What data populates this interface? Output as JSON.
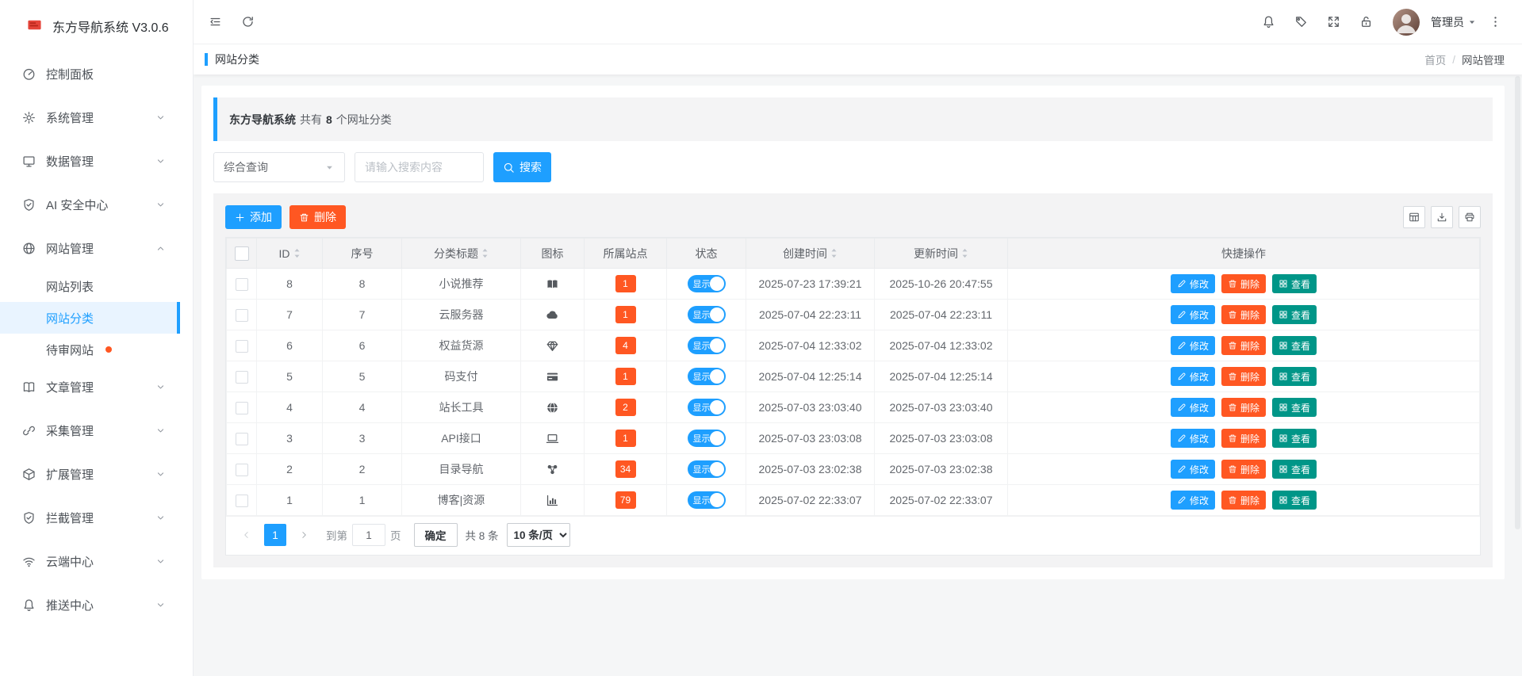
{
  "app": {
    "title": "东方导航系统 V3.0.6",
    "logo_icon": "flag"
  },
  "topbar": {
    "left_icons": [
      {
        "name": "sidebar-collapse-button",
        "icon": "collapse"
      },
      {
        "name": "refresh-button",
        "icon": "refresh"
      }
    ],
    "right_icons": [
      {
        "name": "notifications-button",
        "icon": "bell"
      },
      {
        "name": "tags-button",
        "icon": "tag"
      },
      {
        "name": "fullscreen-button",
        "icon": "expand"
      },
      {
        "name": "lock-screen-button",
        "icon": "unlock"
      }
    ],
    "user": "管理员",
    "more_icon": "kebab"
  },
  "breadcrumb": {
    "page_label": "网站分类",
    "home": "首页",
    "sep": "/",
    "current": "网站管理"
  },
  "sidebar": {
    "items": [
      {
        "label": "控制面板",
        "icon": "dashboard",
        "expandable": false
      },
      {
        "label": "系统管理",
        "icon": "gear",
        "expandable": true
      },
      {
        "label": "数据管理",
        "icon": "monitor",
        "expandable": true
      },
      {
        "label": "AI 安全中心",
        "icon": "shield-check",
        "expandable": true
      },
      {
        "label": "网站管理",
        "icon": "globe",
        "expandable": true,
        "expanded": true,
        "children": [
          {
            "label": "网站列表"
          },
          {
            "label": "网站分类",
            "active": true
          },
          {
            "label": "待审网站",
            "dot": true
          }
        ]
      },
      {
        "label": "文章管理",
        "icon": "book",
        "expandable": true
      },
      {
        "label": "采集管理",
        "icon": "link",
        "expandable": true
      },
      {
        "label": "扩展管理",
        "icon": "cube",
        "expandable": true
      },
      {
        "label": "拦截管理",
        "icon": "shield-check",
        "expandable": true
      },
      {
        "label": "云端中心",
        "icon": "wifi",
        "expandable": true
      },
      {
        "label": "推送中心",
        "icon": "bell",
        "expandable": true
      }
    ]
  },
  "summary": {
    "brand": "东方导航系统",
    "mid": "共有",
    "count": "8",
    "suffix": "个网址分类"
  },
  "search": {
    "select_value": "综合查询",
    "input_placeholder": "请输入搜索内容",
    "button_label": "搜索"
  },
  "toolbar": {
    "add_label": "添加",
    "delete_label": "删除",
    "tools": [
      {
        "name": "filter-columns-button",
        "icon": "columns"
      },
      {
        "name": "export-button",
        "icon": "export"
      },
      {
        "name": "print-button",
        "icon": "print"
      }
    ]
  },
  "table": {
    "columns": [
      {
        "key": "checkbox",
        "label": "",
        "type": "checkbox",
        "sortable": false
      },
      {
        "key": "id",
        "label": "ID",
        "sortable": true
      },
      {
        "key": "order",
        "label": "序号",
        "sortable": false
      },
      {
        "key": "title",
        "label": "分类标题",
        "sortable": true
      },
      {
        "key": "icon",
        "label": "图标",
        "sortable": false
      },
      {
        "key": "site_count",
        "label": "所属站点",
        "sortable": false
      },
      {
        "key": "status",
        "label": "状态",
        "sortable": false
      },
      {
        "key": "created",
        "label": "创建时间",
        "sortable": true
      },
      {
        "key": "updated",
        "label": "更新时间",
        "sortable": true
      },
      {
        "key": "actions",
        "label": "快捷操作",
        "sortable": false
      }
    ],
    "rows": [
      {
        "id": "8",
        "order": "8",
        "title": "小说推荐",
        "icon": "book-open",
        "site_count": "1",
        "status_label": "显示",
        "created": "2025-07-23 17:39:21",
        "updated": "2025-10-26 20:47:55"
      },
      {
        "id": "7",
        "order": "7",
        "title": "云服务器",
        "icon": "cloud",
        "site_count": "1",
        "status_label": "显示",
        "created": "2025-07-04 22:23:11",
        "updated": "2025-07-04 22:23:11"
      },
      {
        "id": "6",
        "order": "6",
        "title": "权益货源",
        "icon": "gem",
        "site_count": "4",
        "status_label": "显示",
        "created": "2025-07-04 12:33:02",
        "updated": "2025-07-04 12:33:02"
      },
      {
        "id": "5",
        "order": "5",
        "title": "码支付",
        "icon": "credit-card",
        "site_count": "1",
        "status_label": "显示",
        "created": "2025-07-04 12:25:14",
        "updated": "2025-07-04 12:25:14"
      },
      {
        "id": "4",
        "order": "4",
        "title": "站长工具",
        "icon": "globe-solid",
        "site_count": "2",
        "status_label": "显示",
        "created": "2025-07-03 23:03:40",
        "updated": "2025-07-03 23:03:40"
      },
      {
        "id": "3",
        "order": "3",
        "title": "API接口",
        "icon": "laptop",
        "site_count": "1",
        "status_label": "显示",
        "created": "2025-07-03 23:03:08",
        "updated": "2025-07-03 23:03:08"
      },
      {
        "id": "2",
        "order": "2",
        "title": "目录导航",
        "icon": "nodes",
        "site_count": "34",
        "status_label": "显示",
        "created": "2025-07-03 23:02:38",
        "updated": "2025-07-03 23:02:38"
      },
      {
        "id": "1",
        "order": "1",
        "title": "博客|资源",
        "icon": "chart",
        "site_count": "79",
        "status_label": "显示",
        "created": "2025-07-02 22:33:07",
        "updated": "2025-07-02 22:33:07"
      }
    ],
    "row_actions": [
      {
        "name": "edit",
        "label": "修改",
        "icon": "pencil",
        "color": "#1e9fff"
      },
      {
        "name": "delete",
        "label": "删除",
        "icon": "trash",
        "color": "#ff5722"
      },
      {
        "name": "view",
        "label": "查看",
        "icon": "grid",
        "color": "#009688"
      }
    ]
  },
  "pagination": {
    "current_page": "1",
    "goto_prefix": "到第",
    "goto_value": "1",
    "goto_suffix": "页",
    "confirm_label": "确定",
    "total_label": "共 8 条",
    "page_size_label": "10 条/页"
  },
  "colors": {
    "primary": "#1e9fff",
    "danger": "#ff5722",
    "success": "#009688",
    "sidebar_active_bg": "#e9f4ff",
    "badge": "#ff5722"
  }
}
